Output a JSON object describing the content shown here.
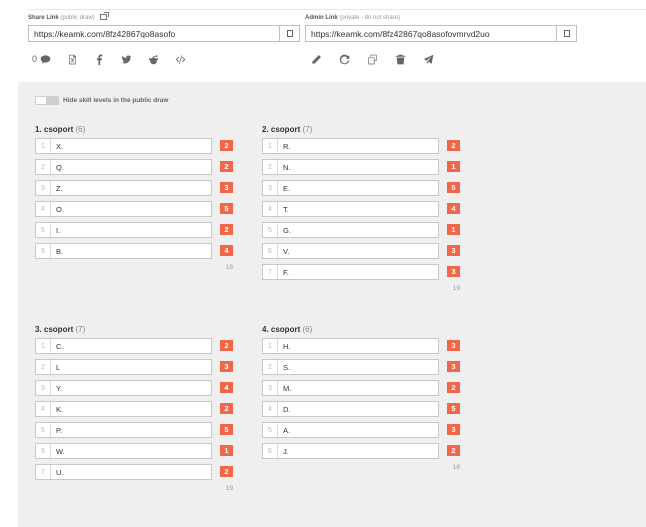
{
  "share": {
    "label": "Share Link",
    "sublabel": "(public draw)",
    "url": "https://keamk.com/8fz42867qo8asofo",
    "comment_count": "0"
  },
  "admin": {
    "label": "Admin Link",
    "sublabel": "(private - do not share)",
    "url": "https://keamk.com/8fz42867qo8asofovmrvd2uo"
  },
  "toggle": {
    "label": "Hide skill levels in the public draw"
  },
  "groups": [
    {
      "title": "1. csoport",
      "count": "(6)",
      "total": "18",
      "members": [
        {
          "num": "1",
          "name": "X.",
          "skill": "2"
        },
        {
          "num": "2",
          "name": "Q.",
          "skill": "2"
        },
        {
          "num": "3",
          "name": "Z.",
          "skill": "3"
        },
        {
          "num": "4",
          "name": "O.",
          "skill": "5"
        },
        {
          "num": "5",
          "name": "I.",
          "skill": "2"
        },
        {
          "num": "6",
          "name": "B.",
          "skill": "4"
        }
      ]
    },
    {
      "title": "2. csoport",
      "count": "(7)",
      "total": "19",
      "members": [
        {
          "num": "1",
          "name": "R.",
          "skill": "2"
        },
        {
          "num": "2",
          "name": "N.",
          "skill": "1"
        },
        {
          "num": "3",
          "name": "E.",
          "skill": "5"
        },
        {
          "num": "4",
          "name": "T.",
          "skill": "4"
        },
        {
          "num": "5",
          "name": "G.",
          "skill": "1"
        },
        {
          "num": "6",
          "name": "V.",
          "skill": "3"
        },
        {
          "num": "7",
          "name": "F.",
          "skill": "3"
        }
      ]
    },
    {
      "title": "3. csoport",
      "count": "(7)",
      "total": "19",
      "members": [
        {
          "num": "1",
          "name": "C.",
          "skill": "2"
        },
        {
          "num": "2",
          "name": "L",
          "skill": "3"
        },
        {
          "num": "3",
          "name": "Y.",
          "skill": "4"
        },
        {
          "num": "4",
          "name": "K.",
          "skill": "2"
        },
        {
          "num": "5",
          "name": "P.",
          "skill": "5"
        },
        {
          "num": "6",
          "name": "W.",
          "skill": "1"
        },
        {
          "num": "7",
          "name": "U.",
          "skill": "2"
        }
      ]
    },
    {
      "title": "4. csoport",
      "count": "(6)",
      "total": "18",
      "members": [
        {
          "num": "1",
          "name": "H.",
          "skill": "3"
        },
        {
          "num": "2",
          "name": "S.",
          "skill": "3"
        },
        {
          "num": "3",
          "name": "M.",
          "skill": "2"
        },
        {
          "num": "4",
          "name": "D.",
          "skill": "5"
        },
        {
          "num": "5",
          "name": "A.",
          "skill": "3"
        },
        {
          "num": "6",
          "name": "J.",
          "skill": "2"
        }
      ]
    }
  ],
  "colors": {
    "skill_badge": "#f0674a",
    "panel_bg": "#efefef"
  },
  "icons": {
    "share": [
      "comment-icon",
      "excel-icon",
      "facebook-icon",
      "twitter-icon",
      "reddit-icon",
      "embed-code-icon"
    ],
    "admin": [
      "edit-pencil-icon",
      "redo-refresh-icon",
      "duplicate-icon",
      "delete-trash-icon",
      "send-icon"
    ]
  }
}
